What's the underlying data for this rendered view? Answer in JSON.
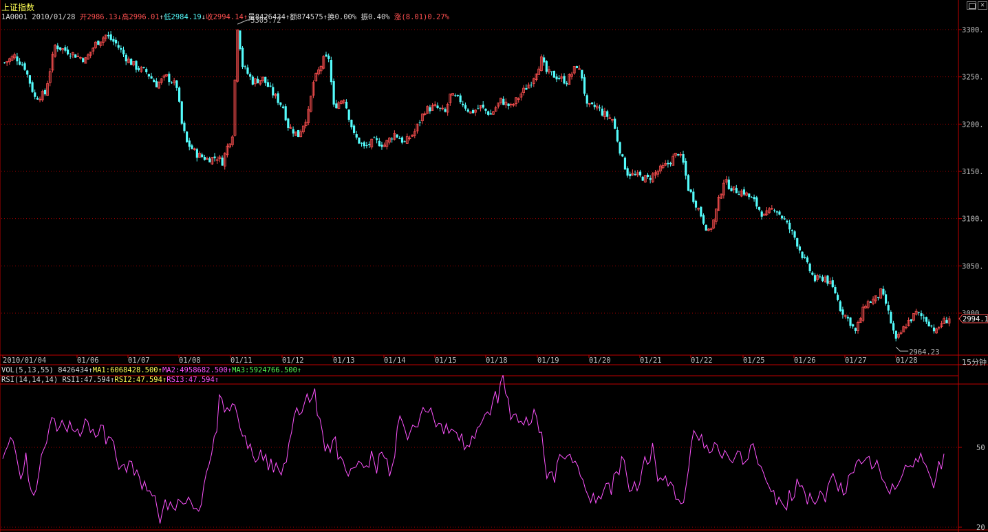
{
  "header": {
    "title": "上证指数",
    "code": "1A0001",
    "date": "2010/01/28",
    "open_label": "开",
    "open": "2986.13",
    "high_label": "高",
    "high": "2996.01",
    "low_label": "低",
    "low": "2984.19",
    "close_label": "收",
    "close": "2994.14",
    "vol_label": "量",
    "vol": "8426434",
    "amount_label": "额",
    "amount": "874575",
    "turnover_label": "换",
    "turnover": "0.00%",
    "amplitude_label": "振",
    "amplitude": "0.40%",
    "change_label": "涨",
    "change": "(8.01)0.27%"
  },
  "vol_indicator": {
    "name": "VOL(5,13,55)",
    "value": "8426434",
    "ma1": "MA1:6068428.500",
    "ma2": "MA2:4958682.500",
    "ma3": "MA3:5924766.500"
  },
  "rsi_indicator": {
    "name": "RSI(14,14,14)",
    "rsi1": "RSI1:47.594",
    "rsi2": "RSI2:47.594",
    "rsi3": "RSI3:47.594"
  },
  "period_label": "15分钟",
  "colors": {
    "up": "#ff5050",
    "down": "#54fcfc",
    "grid": "#a00000",
    "axis": "#c00000",
    "rsi": "#ff54ff"
  },
  "chart_data": [
    {
      "type": "candlestick",
      "y_ticks": [
        3000,
        3050,
        3100,
        3150,
        3200,
        3250,
        3300
      ],
      "y_tick_labels": [
        "3000.",
        "3050.",
        "3100.",
        "3150.",
        "3200.",
        "3250.",
        "3300."
      ],
      "ylim": [
        2962,
        3316
      ],
      "x_tick_labels": [
        "2010/01/04",
        "01/06",
        "01/07",
        "01/08",
        "01/11",
        "01/12",
        "01/13",
        "01/14",
        "01/15",
        "01/18",
        "01/19",
        "01/20",
        "01/21",
        "01/22",
        "01/25",
        "01/26",
        "01/27",
        "01/28"
      ],
      "annotations": {
        "max_label": "3305.72",
        "max_value": 3305.72,
        "min_label": "2964.23",
        "min_value": 2964.23,
        "last_label": "2994.1",
        "last_value": 2994.14
      },
      "close_path": [
        [
          0,
          3265
        ],
        [
          4,
          3272
        ],
        [
          8,
          3260
        ],
        [
          12,
          3228
        ],
        [
          16,
          3232
        ],
        [
          20,
          3283
        ],
        [
          24,
          3278
        ],
        [
          28,
          3273
        ],
        [
          32,
          3268
        ],
        [
          36,
          3285
        ],
        [
          40,
          3294
        ],
        [
          44,
          3285
        ],
        [
          48,
          3270
        ],
        [
          52,
          3260
        ],
        [
          56,
          3255
        ],
        [
          60,
          3242
        ],
        [
          64,
          3250
        ],
        [
          68,
          3240
        ],
        [
          70,
          3200
        ],
        [
          72,
          3180
        ],
        [
          76,
          3168
        ],
        [
          80,
          3163
        ],
        [
          84,
          3165
        ],
        [
          86,
          3160
        ],
        [
          88,
          3176
        ],
        [
          90,
          3190
        ],
        [
          92,
          3303
        ],
        [
          94,
          3262
        ],
        [
          98,
          3245
        ],
        [
          102,
          3248
        ],
        [
          106,
          3232
        ],
        [
          110,
          3218
        ],
        [
          112,
          3198
        ],
        [
          116,
          3188
        ],
        [
          120,
          3212
        ],
        [
          122,
          3244
        ],
        [
          126,
          3268
        ],
        [
          128,
          3270
        ],
        [
          130,
          3218
        ],
        [
          134,
          3228
        ],
        [
          138,
          3188
        ],
        [
          142,
          3175
        ],
        [
          146,
          3182
        ],
        [
          150,
          3178
        ],
        [
          154,
          3190
        ],
        [
          158,
          3180
        ],
        [
          162,
          3192
        ],
        [
          166,
          3215
        ],
        [
          170,
          3218
        ],
        [
          174,
          3212
        ],
        [
          176,
          3230
        ],
        [
          180,
          3225
        ],
        [
          184,
          3212
        ],
        [
          188,
          3218
        ],
        [
          192,
          3210
        ],
        [
          196,
          3225
        ],
        [
          200,
          3218
        ],
        [
          204,
          3232
        ],
        [
          208,
          3245
        ],
        [
          212,
          3268
        ],
        [
          214,
          3255
        ],
        [
          218,
          3250
        ],
        [
          222,
          3245
        ],
        [
          226,
          3262
        ],
        [
          228,
          3250
        ],
        [
          230,
          3218
        ],
        [
          234,
          3218
        ],
        [
          236,
          3212
        ],
        [
          240,
          3205
        ],
        [
          244,
          3162
        ],
        [
          246,
          3148
        ],
        [
          250,
          3145
        ],
        [
          254,
          3142
        ],
        [
          258,
          3150
        ],
        [
          262,
          3158
        ],
        [
          266,
          3170
        ],
        [
          268,
          3158
        ],
        [
          270,
          3132
        ],
        [
          274,
          3110
        ],
        [
          278,
          3085
        ],
        [
          280,
          3098
        ],
        [
          284,
          3140
        ],
        [
          288,
          3130
        ],
        [
          292,
          3128
        ],
        [
          296,
          3118
        ],
        [
          300,
          3102
        ],
        [
          304,
          3112
        ],
        [
          308,
          3098
        ],
        [
          312,
          3080
        ],
        [
          316,
          3055
        ],
        [
          320,
          3035
        ],
        [
          324,
          3038
        ],
        [
          328,
          3022
        ],
        [
          330,
          3005
        ],
        [
          334,
          2990
        ],
        [
          336,
          2980
        ],
        [
          340,
          3010
        ],
        [
          344,
          3015
        ],
        [
          346,
          3022
        ],
        [
          348,
          3010
        ],
        [
          352,
          2970
        ],
        [
          356,
          2988
        ],
        [
          360,
          3000
        ],
        [
          364,
          2993
        ],
        [
          368,
          2980
        ],
        [
          370,
          2990
        ],
        [
          373,
          2994
        ]
      ]
    },
    {
      "type": "line",
      "name": "RSI",
      "y_ticks": [
        20,
        50
      ],
      "y_tick_labels": [
        "20",
        "50"
      ],
      "ylim": [
        20,
        80
      ],
      "values": [
        45.7,
        48.6,
        50.6,
        53.7,
        52.4,
        48.2,
        42.9,
        38.0,
        41.1,
        48.0,
        37.5,
        33.8,
        32.0,
        34.2,
        40.2,
        47.2,
        49.5,
        51.7,
        57.4,
        61.2,
        60.8,
        56.1,
        57.6,
        60.2,
        57.8,
        55.8,
        59.9,
        56.6,
        55.8,
        56.9,
        54.1,
        56.3,
        60.7,
        59.6,
        55.6,
        56.8,
        53.8,
        54.7,
        58.4,
        58.2,
        51.2,
        54.0,
        53.6,
        52.0,
        46.1,
        41.7,
        43.0,
        43.7,
        40.6,
        44.9,
        44.7,
        39.6,
        41.5,
        38.8,
        34.2,
        37.3,
        33.6,
        33.7,
        31.7,
        31.9,
        26.5,
        21.4,
        26.3,
        30.4,
        26.6,
        29.5,
        27.3,
        26.3,
        30.5,
        29.7,
        28.7,
        29.0,
        31.3,
        29.5,
        26.9,
        27.1,
        26.0,
        28.5,
        35.8,
        40.7,
        43.5,
        47.6,
        54.1,
        56.0,
        69.7,
        68.2,
        63.3,
        64.9,
        63.7,
        66.4,
        65.9,
        62.1,
        57.2,
        54.2,
        54.4,
        49.5,
        51.3,
        46.8,
        44.5,
        45.5,
        49.1,
        45.0,
        47.4,
        41.4,
        45.7,
        40.6,
        44.2,
        41.6,
        39.6,
        43.8,
        44.5,
        51.7,
        55.7,
        61.9,
        64.9,
        62.2,
        63.1,
        66.6,
        70.1,
        66.9,
        68.8,
        72.1,
        62.0,
        60.8,
        55.7,
        48.5,
        51.2,
        48.1,
        52.7,
        53.9,
        45.5,
        46.5,
        44.9,
        41.3,
        39.2,
        42.0,
        42.3,
        42.6,
        44.8,
        44.1,
        42.4,
        43.1,
        42.5,
        48.7,
        44.8,
        40.2,
        47.5,
        48.2,
        46.1,
        45.6,
        39.1,
        42.9,
        46.5,
        57.5,
        61.8,
        59.6,
        56.5,
        52.9,
        55.8,
        58.4,
        57.7,
        57.7,
        62.2,
        65.0,
        63.4,
        63.2,
        64.8,
        61.3,
        57.7,
        59.0,
        58.8,
        55.0,
        58.9,
        55.3,
        56.9,
        56.2,
        55.5,
        52.5,
        55.2,
        49.1,
        50.7,
        50.3,
        54.3,
        53.3,
        57.3,
        58.1,
        60.0,
        62.4,
        63.3,
        62.2,
        67.2,
        71.1,
        66.5,
        74.4,
        77.1,
        70.2,
        68.4,
        60.4,
        62.2,
        62.6,
        59.4,
        59.8,
        58.4,
        61.4,
        58.3,
        59.3,
        64.3,
        61.6,
        55.6,
        55.7,
        46.0,
        38.3,
        40.6,
        40.8,
        36.7,
        44.3,
        47.3,
        46.4,
        45.6,
        46.9,
        47.4,
        44.2,
        44.8,
        43.0,
        39.2,
        37.8,
        34.1,
        31.9,
        29.2,
        32.7,
        29.1,
        31.7,
        30.6,
        33.8,
        36.4,
        36.6,
        32.2,
        39.9,
        40.9,
        39.7,
        46.5,
        45.2,
        39.2,
        33.4,
        33.9,
        37.1,
        33.7,
        36.3,
        42.2,
        46.5,
        43.6,
        44.6,
        51.6,
        44.9,
        37.3,
        38.6,
        37.6,
        39.3,
        35.5,
        37.0,
        35.5,
        30.5,
        30.5,
        28.8,
        29.2,
        35.6,
        42.3,
        51.3,
        56.3,
        54.6,
        52.6,
        54.8,
        49.7,
        50.9,
        47.9,
        48.4,
        51.8,
        51.0,
        47.6,
        45.9,
        48.9,
        47.2,
        45.3,
        44.2,
        46.4,
        48.7,
        48.3,
        43.6,
        44.6,
        45.6,
        50.7,
        51.4,
        47.5,
        43.5,
        42.9,
        40.5,
        37.5,
        35.6,
        33.3,
        33.8,
        28.6,
        31.3,
        29.3,
        27.8,
        26.5,
        33.9,
        30.0,
        31.4,
        38.2,
        35.4,
        35.6,
        33.1,
        28.6,
        32.8,
        30.0,
        28.6,
        30.3,
        33.6,
        32.4,
        29.4,
        35.6,
        38.2,
        40.2,
        37.3,
        33.6,
        36.6,
        32.1,
        32.9,
        39.4,
        40.3,
        40.5,
        44.4,
        45.5,
        43.8,
        44.8,
        46.1,
        46.6,
        41.9,
        42.8,
        45.2,
        41.7,
        38.0,
        36.8,
        34.3,
        32.5,
        36.3,
        34.2,
        35.6,
        37.6,
        39.9,
        43.3,
        42.7,
        43.1,
        42.6,
        45.8,
        44.5,
        47.8,
        44.5,
        43.3,
        40.7,
        38.2,
        34.7,
        39.0,
        44.8,
        41.8,
        47.6
      ]
    }
  ]
}
